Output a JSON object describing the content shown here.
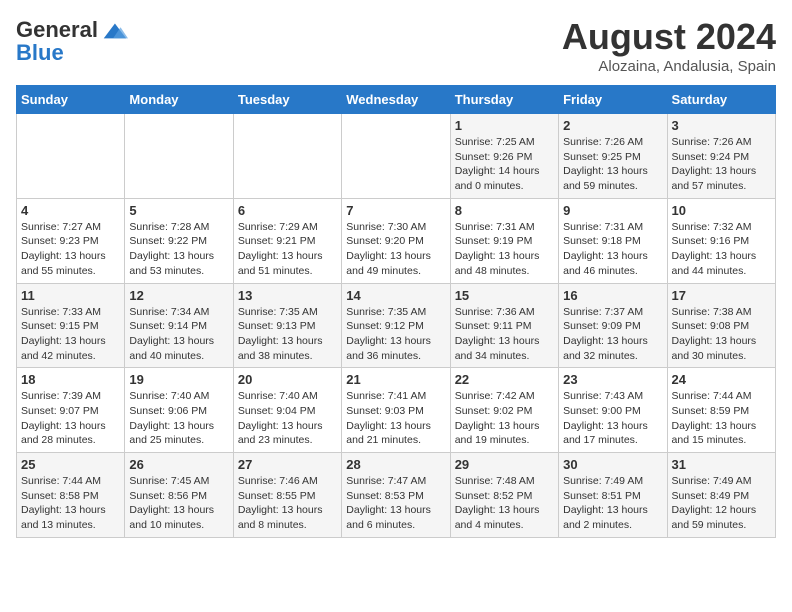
{
  "header": {
    "logo_line1": "General",
    "logo_line2": "Blue",
    "month_title": "August 2024",
    "subtitle": "Alozaina, Andalusia, Spain"
  },
  "days_of_week": [
    "Sunday",
    "Monday",
    "Tuesday",
    "Wednesday",
    "Thursday",
    "Friday",
    "Saturday"
  ],
  "weeks": [
    [
      {
        "day": "",
        "info": ""
      },
      {
        "day": "",
        "info": ""
      },
      {
        "day": "",
        "info": ""
      },
      {
        "day": "",
        "info": ""
      },
      {
        "day": "1",
        "info": "Sunrise: 7:25 AM\nSunset: 9:26 PM\nDaylight: 14 hours\nand 0 minutes."
      },
      {
        "day": "2",
        "info": "Sunrise: 7:26 AM\nSunset: 9:25 PM\nDaylight: 13 hours\nand 59 minutes."
      },
      {
        "day": "3",
        "info": "Sunrise: 7:26 AM\nSunset: 9:24 PM\nDaylight: 13 hours\nand 57 minutes."
      }
    ],
    [
      {
        "day": "4",
        "info": "Sunrise: 7:27 AM\nSunset: 9:23 PM\nDaylight: 13 hours\nand 55 minutes."
      },
      {
        "day": "5",
        "info": "Sunrise: 7:28 AM\nSunset: 9:22 PM\nDaylight: 13 hours\nand 53 minutes."
      },
      {
        "day": "6",
        "info": "Sunrise: 7:29 AM\nSunset: 9:21 PM\nDaylight: 13 hours\nand 51 minutes."
      },
      {
        "day": "7",
        "info": "Sunrise: 7:30 AM\nSunset: 9:20 PM\nDaylight: 13 hours\nand 49 minutes."
      },
      {
        "day": "8",
        "info": "Sunrise: 7:31 AM\nSunset: 9:19 PM\nDaylight: 13 hours\nand 48 minutes."
      },
      {
        "day": "9",
        "info": "Sunrise: 7:31 AM\nSunset: 9:18 PM\nDaylight: 13 hours\nand 46 minutes."
      },
      {
        "day": "10",
        "info": "Sunrise: 7:32 AM\nSunset: 9:16 PM\nDaylight: 13 hours\nand 44 minutes."
      }
    ],
    [
      {
        "day": "11",
        "info": "Sunrise: 7:33 AM\nSunset: 9:15 PM\nDaylight: 13 hours\nand 42 minutes."
      },
      {
        "day": "12",
        "info": "Sunrise: 7:34 AM\nSunset: 9:14 PM\nDaylight: 13 hours\nand 40 minutes."
      },
      {
        "day": "13",
        "info": "Sunrise: 7:35 AM\nSunset: 9:13 PM\nDaylight: 13 hours\nand 38 minutes."
      },
      {
        "day": "14",
        "info": "Sunrise: 7:35 AM\nSunset: 9:12 PM\nDaylight: 13 hours\nand 36 minutes."
      },
      {
        "day": "15",
        "info": "Sunrise: 7:36 AM\nSunset: 9:11 PM\nDaylight: 13 hours\nand 34 minutes."
      },
      {
        "day": "16",
        "info": "Sunrise: 7:37 AM\nSunset: 9:09 PM\nDaylight: 13 hours\nand 32 minutes."
      },
      {
        "day": "17",
        "info": "Sunrise: 7:38 AM\nSunset: 9:08 PM\nDaylight: 13 hours\nand 30 minutes."
      }
    ],
    [
      {
        "day": "18",
        "info": "Sunrise: 7:39 AM\nSunset: 9:07 PM\nDaylight: 13 hours\nand 28 minutes."
      },
      {
        "day": "19",
        "info": "Sunrise: 7:40 AM\nSunset: 9:06 PM\nDaylight: 13 hours\nand 25 minutes."
      },
      {
        "day": "20",
        "info": "Sunrise: 7:40 AM\nSunset: 9:04 PM\nDaylight: 13 hours\nand 23 minutes."
      },
      {
        "day": "21",
        "info": "Sunrise: 7:41 AM\nSunset: 9:03 PM\nDaylight: 13 hours\nand 21 minutes."
      },
      {
        "day": "22",
        "info": "Sunrise: 7:42 AM\nSunset: 9:02 PM\nDaylight: 13 hours\nand 19 minutes."
      },
      {
        "day": "23",
        "info": "Sunrise: 7:43 AM\nSunset: 9:00 PM\nDaylight: 13 hours\nand 17 minutes."
      },
      {
        "day": "24",
        "info": "Sunrise: 7:44 AM\nSunset: 8:59 PM\nDaylight: 13 hours\nand 15 minutes."
      }
    ],
    [
      {
        "day": "25",
        "info": "Sunrise: 7:44 AM\nSunset: 8:58 PM\nDaylight: 13 hours\nand 13 minutes."
      },
      {
        "day": "26",
        "info": "Sunrise: 7:45 AM\nSunset: 8:56 PM\nDaylight: 13 hours\nand 10 minutes."
      },
      {
        "day": "27",
        "info": "Sunrise: 7:46 AM\nSunset: 8:55 PM\nDaylight: 13 hours\nand 8 minutes."
      },
      {
        "day": "28",
        "info": "Sunrise: 7:47 AM\nSunset: 8:53 PM\nDaylight: 13 hours\nand 6 minutes."
      },
      {
        "day": "29",
        "info": "Sunrise: 7:48 AM\nSunset: 8:52 PM\nDaylight: 13 hours\nand 4 minutes."
      },
      {
        "day": "30",
        "info": "Sunrise: 7:49 AM\nSunset: 8:51 PM\nDaylight: 13 hours\nand 2 minutes."
      },
      {
        "day": "31",
        "info": "Sunrise: 7:49 AM\nSunset: 8:49 PM\nDaylight: 12 hours\nand 59 minutes."
      }
    ]
  ]
}
